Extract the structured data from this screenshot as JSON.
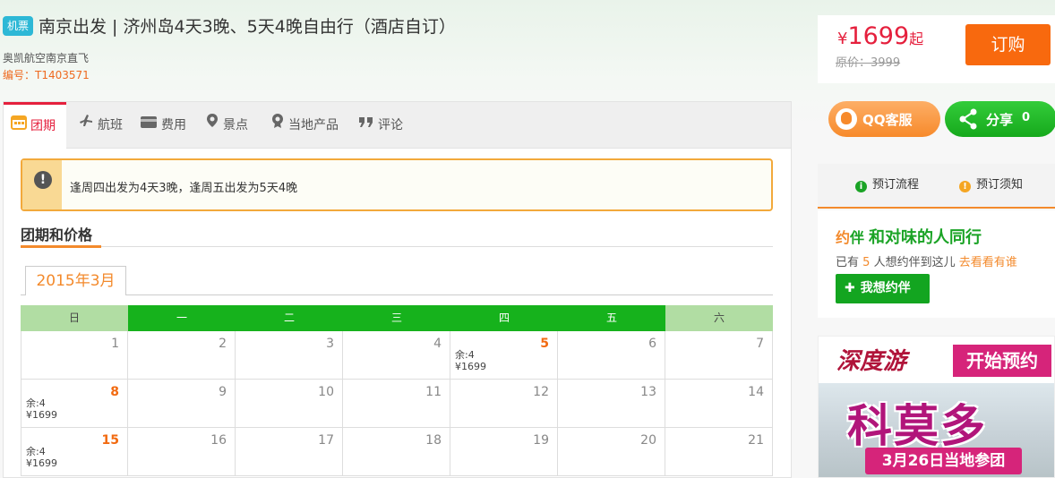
{
  "header": {
    "tag": "机票",
    "title": "南京出发 | 济州岛4天3晚、5天4晚自由行（酒店自订）",
    "airline": "奥凯航空南京直飞",
    "code": "编号：T1403571"
  },
  "price": {
    "currency": "¥",
    "amount": "1699",
    "suffix": "起",
    "original": "原价：3999",
    "book_label": "订购"
  },
  "actions": {
    "qq_label": "QQ客服",
    "share_label": "分享",
    "share_count": "0"
  },
  "booking_links": {
    "process": "预订流程",
    "notice": "预订须知"
  },
  "companion": {
    "logo_a": "约",
    "logo_b": "伴",
    "title": "和对味的人同行",
    "line_prefix": "已有",
    "count": "5",
    "line_suffix": "人想约伴到这儿",
    "link": "去看看有谁",
    "button": "我想约伴"
  },
  "promo": {
    "brand": "深度游",
    "open": "开始预约",
    "big": "科莫多",
    "date": "3月26日当地参团"
  },
  "tabs": [
    {
      "label": "团期",
      "icon": "calendar-icon"
    },
    {
      "label": "航班",
      "icon": "plane-icon"
    },
    {
      "label": "费用",
      "icon": "wallet-icon"
    },
    {
      "label": "景点",
      "icon": "location-icon"
    },
    {
      "label": "当地产品",
      "icon": "badge-icon"
    },
    {
      "label": "评论",
      "icon": "quote-icon"
    }
  ],
  "notice": "逢周四出发为4天3晚，逢周五出发为5天4晚",
  "section_title": "团期和价格",
  "month": "2015年3月",
  "calendar": {
    "weekdays": [
      "日",
      "一",
      "二",
      "三",
      "四",
      "五",
      "六"
    ],
    "rows": [
      [
        {
          "day": "1"
        },
        {
          "day": "2"
        },
        {
          "day": "3"
        },
        {
          "day": "4"
        },
        {
          "day": "5",
          "hot": true,
          "remain": "余:4",
          "price": "¥1699"
        },
        {
          "day": "6"
        },
        {
          "day": "7"
        }
      ],
      [
        {
          "day": "8",
          "hot": true,
          "remain": "余:4",
          "price": "¥1699"
        },
        {
          "day": "9"
        },
        {
          "day": "10"
        },
        {
          "day": "11"
        },
        {
          "day": "12"
        },
        {
          "day": "13"
        },
        {
          "day": "14"
        }
      ],
      [
        {
          "day": "15",
          "hot": true,
          "remain": "余:4",
          "price": "¥1699"
        },
        {
          "day": "16"
        },
        {
          "day": "17"
        },
        {
          "day": "18"
        },
        {
          "day": "19"
        },
        {
          "day": "20"
        },
        {
          "day": "21"
        }
      ]
    ]
  },
  "colors": {
    "accent_orange": "#f8690e",
    "price_red": "#e5203d",
    "calendar_green": "#16b21c",
    "weekend_green": "#b1dda3"
  }
}
